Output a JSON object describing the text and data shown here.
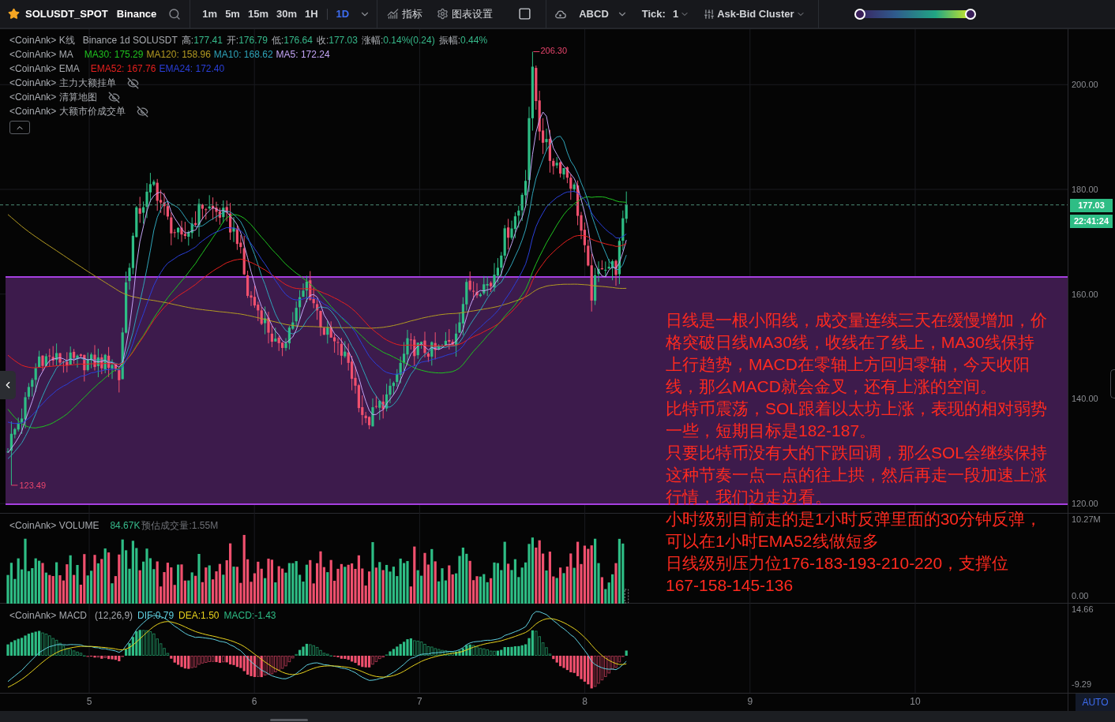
{
  "toolbar": {
    "favorite": true,
    "symbol": "SOLUSDT_SPOT",
    "exchange": "Binance",
    "intervals": [
      {
        "label": "1m",
        "selected": false
      },
      {
        "label": "5m",
        "selected": false
      },
      {
        "label": "15m",
        "selected": false
      },
      {
        "label": "30m",
        "selected": false
      },
      {
        "label": "1H",
        "selected": false
      },
      {
        "label": "1D",
        "selected": true
      }
    ],
    "tools": [
      {
        "kind": "indicators",
        "label": "指标"
      },
      {
        "kind": "settings",
        "label": "图表设置"
      },
      {
        "kind": "layout"
      }
    ],
    "drawing_tool": "ABCD",
    "tick_label": "Tick:",
    "tick_value": "1",
    "cluster": "Ask-Bid Cluster",
    "heatmap_slider": {
      "handles": [
        {
          "level": 0
        },
        {
          "level": 1
        }
      ]
    }
  },
  "legend": {
    "rows": [
      {
        "kind": "ohlc",
        "label": "<CoinAnk> K线",
        "info": "Binance 1d SOLUSDT",
        "fields": [
          {
            "label": "高:",
            "value": "177.41"
          },
          {
            "label": "开:",
            "value": "176.79"
          },
          {
            "label": "低:",
            "value": "176.64"
          },
          {
            "label": "收:",
            "value": "177.03"
          },
          {
            "label": "涨幅:",
            "value": "0.14%(0.24)"
          },
          {
            "label": "振幅:",
            "value": "0.44%"
          }
        ]
      },
      {
        "kind": "series",
        "label": "<CoinAnk> MA",
        "series": [
          {
            "text": "MA30: 175.29",
            "color": "#1fc21f"
          },
          {
            "text": "MA120: 158.96",
            "color": "#b39a22"
          },
          {
            "text": "MA10: 168.62",
            "color": "#2ea3b8"
          },
          {
            "text": "MA5: 172.24",
            "color": "#c3a4f5"
          }
        ]
      },
      {
        "kind": "series",
        "label": "<CoinAnk> EMA",
        "series": [
          {
            "text": "EMA52: 167.76",
            "color": "#e5201e"
          },
          {
            "text": "EMA24: 172.40",
            "color": "#2a3fd9"
          }
        ]
      },
      {
        "kind": "overlay",
        "label": "<CoinAnk> 主力大额挂单",
        "visible": false
      },
      {
        "kind": "overlay",
        "label": "<CoinAnk> 清算地图",
        "visible": false
      },
      {
        "kind": "overlay",
        "label": "<CoinAnk> 大额市价成交单",
        "visible": false
      }
    ]
  },
  "price_pane": {
    "y_ticks": [
      "200.00",
      "180.00",
      "160.00",
      "140.00",
      "120.00"
    ],
    "high_marker": "206.30",
    "low_marker": "123.49",
    "last_price": "177.03",
    "countdown": "22:41:24"
  },
  "note": {
    "lines": [
      "日线是一根小阳线，成交量连续三天在缓慢增加，价格突破日线MA30线，收线在了线上，MA30线保持上行趋势，MACD在零轴上方回归零轴，今天收阳线，那么MACD就会金叉，还有上涨的空间。",
      "比特币震荡，SOL跟着以太坊上涨，表现的相对弱势一些，短期目标是182-187。",
      "只要比特币没有大的下跌回调，那么SOL会继续保持这种节奏一点一点的往上拱，然后再走一段加速上涨行情，我们边走边看。",
      "小时级别目前走的是1小时反弹里面的30分钟反弹，",
      "可以在1小时EMA52线做短多",
      "日线级别压力位176-183-193-210-220，支撑位",
      "167-158-145-136"
    ]
  },
  "volume_pane": {
    "label": "<CoinAnk> VOLUME",
    "value": "84.67K",
    "estimate": "预估成交量:1.55M",
    "y_ticks": [
      "10.27M",
      "0.00"
    ]
  },
  "macd_pane": {
    "label": "<CoinAnk> MACD",
    "params": "(12,26,9)",
    "series": [
      {
        "text": "DIF:0.79",
        "color": "#5fd0e0"
      },
      {
        "text": "DEA:1.50",
        "color": "#e8d21c"
      },
      {
        "text": "MACD:-1.43",
        "color": "#2ebd85"
      }
    ],
    "y_ticks": [
      "14.66",
      "-9.29"
    ]
  },
  "x_axis": {
    "labels": [
      "5",
      "6",
      "7",
      "8",
      "9",
      "10"
    ],
    "auto_button": "AUTO"
  }
}
